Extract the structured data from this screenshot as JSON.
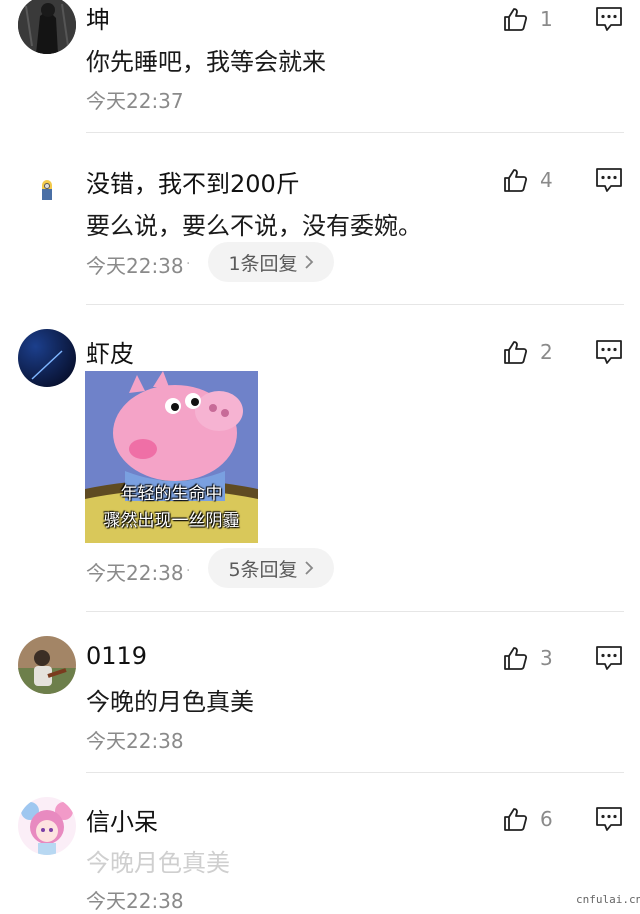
{
  "comments": [
    {
      "name": "坤",
      "text": "你先睡吧，我等会就来",
      "time": "今天22:37",
      "likes": "1",
      "avatar_icon": "dark-photo-avatar"
    },
    {
      "name": "没错，我不到200斤",
      "text": "要么说，要么不说，没有委婉。",
      "time": "今天22:38",
      "dot": "·",
      "replies": "1条回复",
      "likes": "4",
      "avatar_icon": "minion-avatar"
    },
    {
      "name": "虾皮",
      "time": "今天22:38",
      "replies": "5条回复",
      "likes": "2",
      "avatar_icon": "blue-night-avatar",
      "sticker": {
        "line1": "年轻的生命中",
        "line2": "骤然出现一丝阴霾",
        "icon": "peppa-pig-sticker"
      }
    },
    {
      "name": "0119",
      "text": "今晚的月色真美",
      "time": "今天22:38",
      "likes": "3",
      "avatar_icon": "photo-avatar"
    },
    {
      "name": "信小呆",
      "text": "今晚月色真美",
      "time": "今天22:38",
      "likes": "6",
      "avatar_icon": "anime-girl-avatar"
    }
  ],
  "watermark": "cnfulai.cn",
  "colors": {
    "meta_gray": "#8a8a8a",
    "divider": "#e6e6e6",
    "pill_bg": "#f3f3f3"
  }
}
